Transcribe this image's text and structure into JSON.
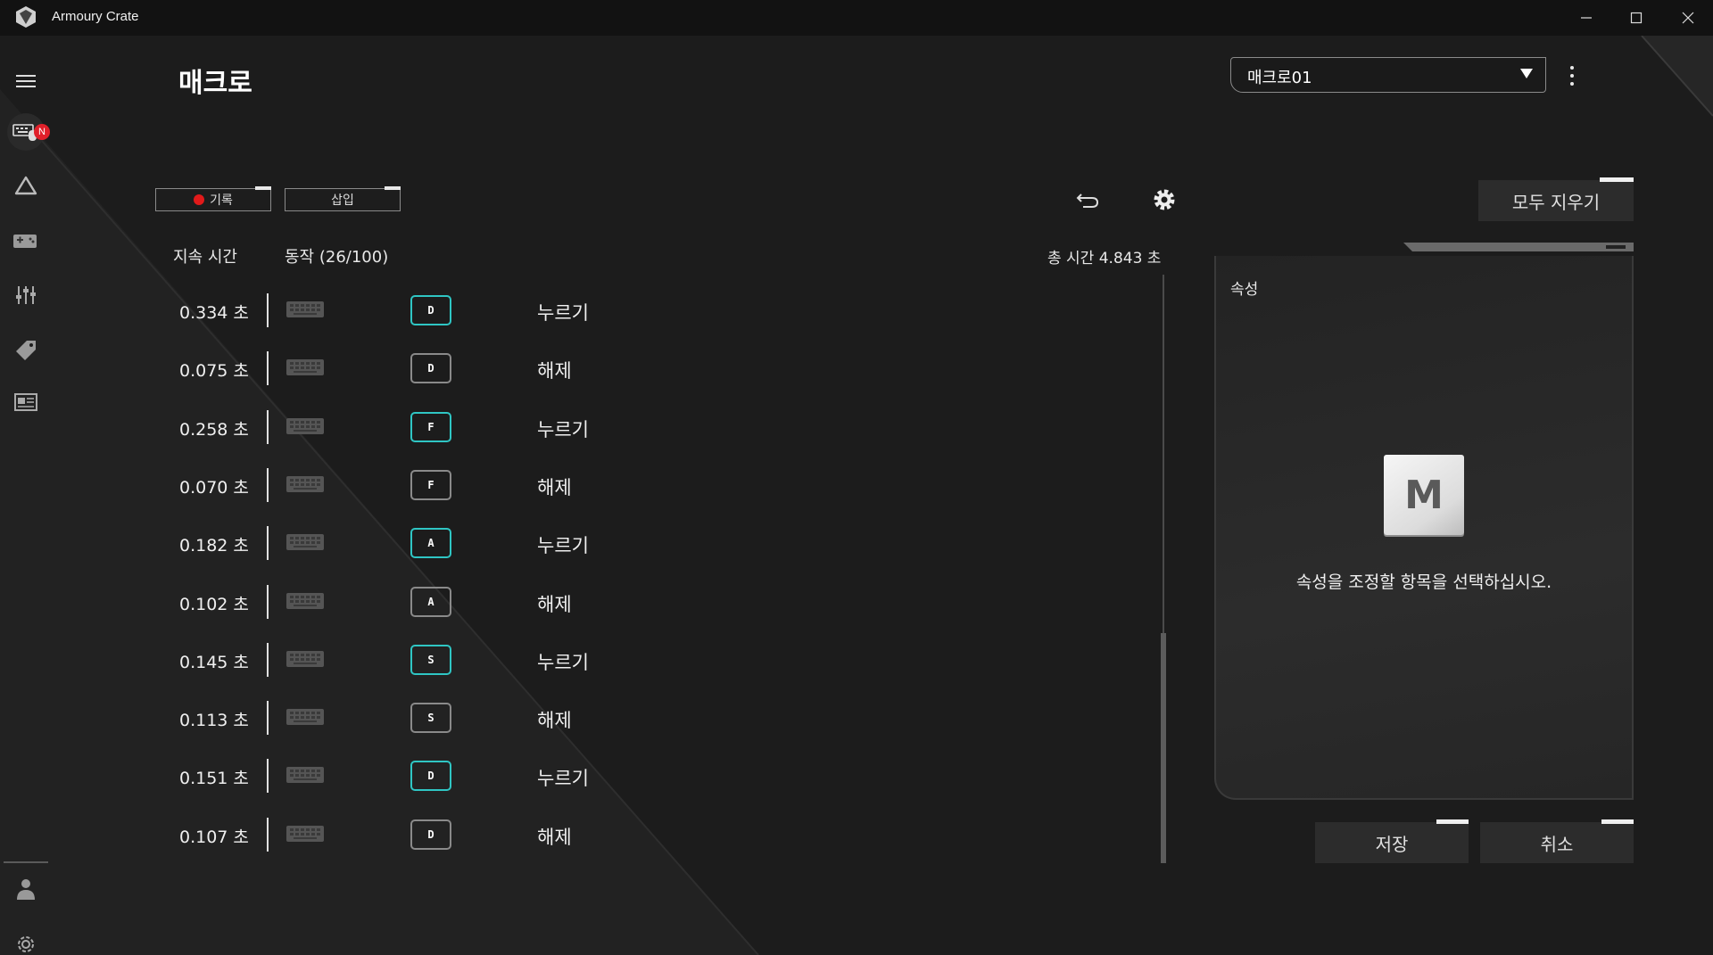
{
  "window": {
    "title": "Armoury Crate",
    "icons": [
      "app-logo-icon",
      "minimize-icon",
      "maximize-icon",
      "close-icon"
    ]
  },
  "sidebar": {
    "items": [
      {
        "name": "menu-icon"
      },
      {
        "name": "device-icon",
        "badge": "N"
      },
      {
        "name": "aura-icon"
      },
      {
        "name": "gamevisual-icon"
      },
      {
        "name": "equalizer-icon"
      },
      {
        "name": "deals-icon"
      },
      {
        "name": "news-icon"
      },
      {
        "name": "user-icon"
      },
      {
        "name": "settings-icon"
      }
    ]
  },
  "header": {
    "title": "매크로",
    "profile_select": "매크로01"
  },
  "toolbar": {
    "record_label": "기록",
    "insert_label": "삽입",
    "clear_all_label": "모두 지우기"
  },
  "list": {
    "col_duration": "지속 시간",
    "col_action": "동작 (26/100)",
    "total_time": "총 시간 4.843 초",
    "rows": [
      {
        "duration": "0.334 초",
        "key": "D",
        "action": "누르기",
        "press": true
      },
      {
        "duration": "0.075 초",
        "key": "D",
        "action": "해제",
        "press": false
      },
      {
        "duration": "0.258 초",
        "key": "F",
        "action": "누르기",
        "press": true
      },
      {
        "duration": "0.070 초",
        "key": "F",
        "action": "해제",
        "press": false
      },
      {
        "duration": "0.182 초",
        "key": "A",
        "action": "누르기",
        "press": true
      },
      {
        "duration": "0.102 초",
        "key": "A",
        "action": "해제",
        "press": false
      },
      {
        "duration": "0.145 초",
        "key": "S",
        "action": "누르기",
        "press": true
      },
      {
        "duration": "0.113 초",
        "key": "S",
        "action": "해제",
        "press": false
      },
      {
        "duration": "0.151 초",
        "key": "D",
        "action": "누르기",
        "press": true
      },
      {
        "duration": "0.107 초",
        "key": "D",
        "action": "해제",
        "press": false
      }
    ]
  },
  "properties": {
    "title": "속성",
    "key_letter": "M",
    "hint": "속성을 조정할 항목을 선택하십시오."
  },
  "footer": {
    "save_label": "저장",
    "cancel_label": "취소"
  },
  "colors": {
    "accent_teal": "#2fc6c4",
    "record_red": "#e11a1a",
    "badge_red": "#e0202a"
  }
}
